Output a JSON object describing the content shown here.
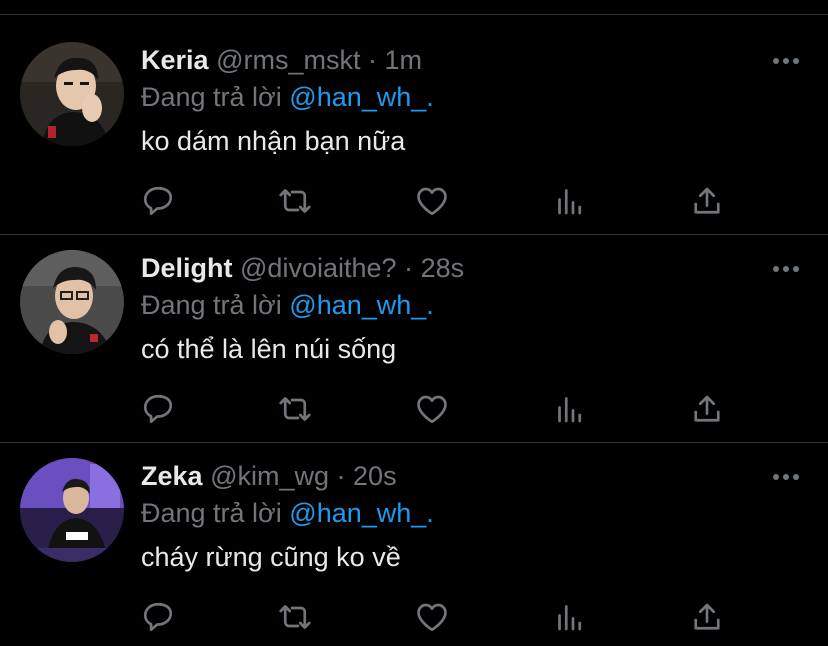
{
  "colors": {
    "background": "#000000",
    "text_primary": "#e7e9ea",
    "text_secondary": "#71767b",
    "link": "#1d9bf0",
    "divider": "#2f3336"
  },
  "tweets": [
    {
      "display_name": "Keria",
      "handle": "@rms_mskt",
      "separator": "·",
      "time": "1m",
      "reply_prefix": "Đang trả lời",
      "reply_target": "@han_wh_.",
      "text": "ko dám nhận bạn nữa",
      "avatar_icon": "avatar-keria"
    },
    {
      "display_name": "Delight",
      "handle": "@divoiaithe?",
      "separator": "·",
      "time": "28s",
      "reply_prefix": "Đang trả lời",
      "reply_target": "@han_wh_.",
      "text": "có thể là lên núi sống",
      "avatar_icon": "avatar-delight"
    },
    {
      "display_name": "Zeka",
      "handle": "@kim_wg",
      "separator": "·",
      "time": "20s",
      "reply_prefix": "Đang trả lời",
      "reply_target": "@han_wh_.",
      "text": "cháy rừng cũng ko về",
      "avatar_icon": "avatar-zeka"
    }
  ],
  "actions": [
    "reply-icon",
    "retweet-icon",
    "like-icon",
    "analytics-icon",
    "share-icon"
  ]
}
